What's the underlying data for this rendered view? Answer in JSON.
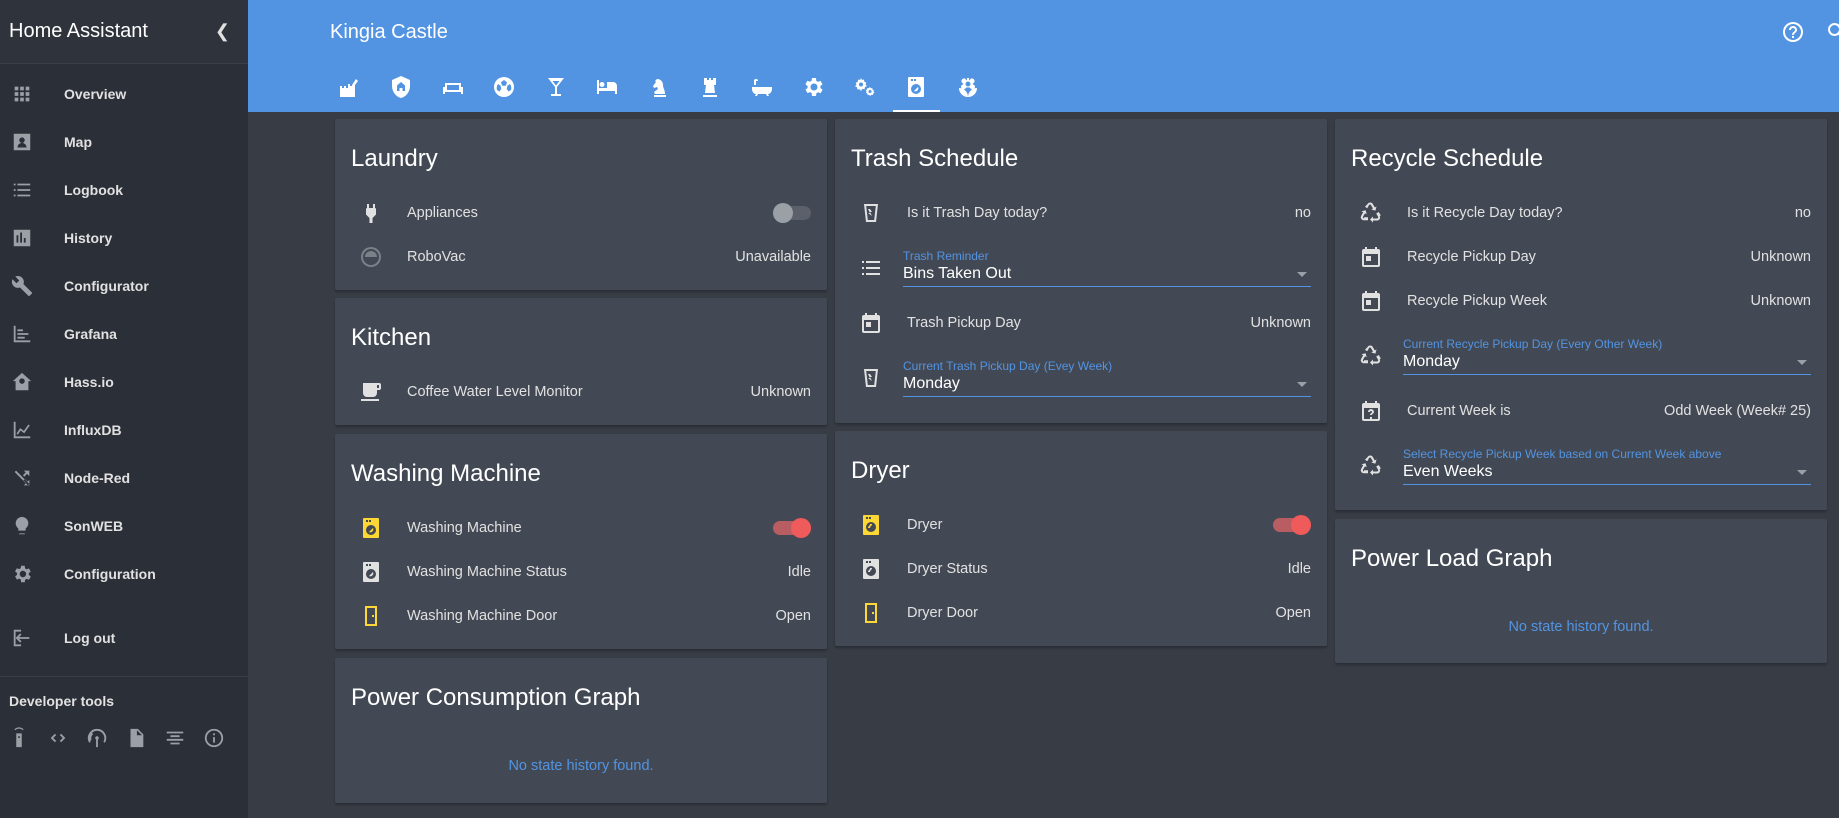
{
  "app": {
    "title": "Home Assistant",
    "page_title": "Kingia Castle"
  },
  "sidebar": {
    "items": [
      {
        "label": "Overview",
        "icon": "apps-icon"
      },
      {
        "label": "Map",
        "icon": "map-icon"
      },
      {
        "label": "Logbook",
        "icon": "logbook-icon"
      },
      {
        "label": "History",
        "icon": "history-icon"
      },
      {
        "label": "Configurator",
        "icon": "wrench-icon"
      },
      {
        "label": "Grafana",
        "icon": "grafana-icon"
      },
      {
        "label": "Hass.io",
        "icon": "hassio-icon"
      },
      {
        "label": "InfluxDB",
        "icon": "chart-icon"
      },
      {
        "label": "Node-Red",
        "icon": "shuffle-icon"
      },
      {
        "label": "SonWEB",
        "icon": "bulb-icon"
      },
      {
        "label": "Configuration",
        "icon": "gear-icon"
      }
    ],
    "logout": "Log out",
    "dev_tools_title": "Developer tools"
  },
  "tabs": [
    "castle-home",
    "shield-home",
    "sofa",
    "soccer",
    "cocktail",
    "bed",
    "chess-knight",
    "chess-rook",
    "bathtub",
    "cog",
    "cogs",
    "washing-machine",
    "flower"
  ],
  "laundry": {
    "title": "Laundry",
    "appliances": "Appliances",
    "robovac": "RoboVac",
    "robovac_state": "Unavailable"
  },
  "kitchen": {
    "title": "Kitchen",
    "coffee": "Coffee Water Level Monitor",
    "coffee_state": "Unknown"
  },
  "washing": {
    "title": "Washing Machine",
    "machine": "Washing Machine",
    "status": "Washing Machine Status",
    "status_state": "Idle",
    "door": "Washing Machine Door",
    "door_state": "Open"
  },
  "power_consumption": {
    "title": "Power Consumption Graph",
    "empty": "No state history found."
  },
  "trash": {
    "title": "Trash Schedule",
    "trash_day": "Is it Trash Day today?",
    "trash_day_state": "no",
    "reminder_label": "Trash Reminder",
    "reminder_value": "Bins Taken Out",
    "pickup_day": "Trash Pickup Day",
    "pickup_day_state": "Unknown",
    "current_label": "Current Trash Pickup Day (Evey Week)",
    "current_value": "Monday"
  },
  "dryer": {
    "title": "Dryer",
    "dryer": "Dryer",
    "status": "Dryer Status",
    "status_state": "Idle",
    "door": "Dryer Door",
    "door_state": "Open"
  },
  "recycle": {
    "title": "Recycle Schedule",
    "recycle_day": "Is it Recycle Day today?",
    "recycle_day_state": "no",
    "pickup_day": "Recycle Pickup Day",
    "pickup_day_state": "Unknown",
    "pickup_week": "Recycle Pickup Week",
    "pickup_week_state": "Unknown",
    "current_day_label": "Current Recycle Pickup Day (Every Other Week)",
    "current_day_value": "Monday",
    "current_week": "Current Week is",
    "current_week_state": "Odd Week (Week# 25)",
    "select_week_label": "Select Recycle Pickup Week based on Current Week above",
    "select_week_value": "Even Weeks"
  },
  "power_load": {
    "title": "Power Load Graph",
    "empty": "No state history found."
  }
}
